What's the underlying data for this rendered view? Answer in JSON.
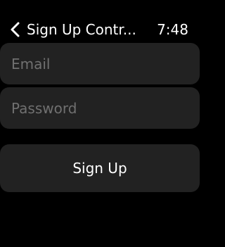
{
  "nav": {
    "title": "Sign Up Contr...",
    "back_icon": "chevron-left-icon"
  },
  "status": {
    "time": "7:48"
  },
  "form": {
    "email_placeholder": "Email",
    "password_placeholder": "Password",
    "signup_label": "Sign Up"
  },
  "colors": {
    "background": "#000000",
    "surface": "#222222",
    "placeholder": "#707070",
    "text": "#ffffff"
  }
}
